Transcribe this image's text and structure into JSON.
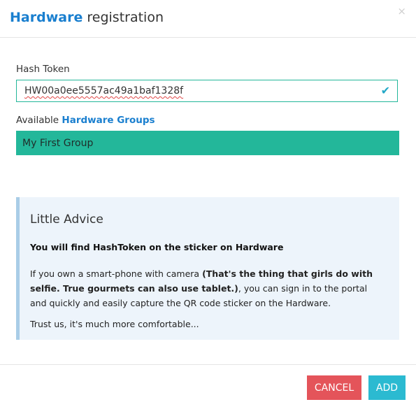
{
  "dialog": {
    "title_strong": "Hardware",
    "title_rest": " registration",
    "close_glyph": "×"
  },
  "hash_token": {
    "label": "Hash Token",
    "value": "HW00a0ee5557ac49a1baf1328f",
    "valid_icon": "check-icon",
    "check_glyph": "✔"
  },
  "groups": {
    "label_prefix": "Available ",
    "label_strong": "Hardware Groups",
    "selected": "My First Group"
  },
  "advice": {
    "title": "Little Advice",
    "bold_line": "You will find HashToken on the sticker on Hardware",
    "para_part1": "If you own a smart-phone with camera ",
    "para_bold": "(That's the thing that girls do with selfie. True gourmets can also use tablet.)",
    "para_part2": ", you can sign in to the portal and quickly and easily capture the QR code sticker on the Hardware.",
    "trust": "Trust us, it's much more comfortable..."
  },
  "footer": {
    "cancel_label": "CANCEL",
    "add_label": "ADD"
  },
  "colors": {
    "accent_blue": "#1a7fcf",
    "group_green": "#23b79a",
    "cancel_red": "#e4545a",
    "add_cyan": "#2bbad1",
    "advice_bg": "#edf4fb"
  }
}
